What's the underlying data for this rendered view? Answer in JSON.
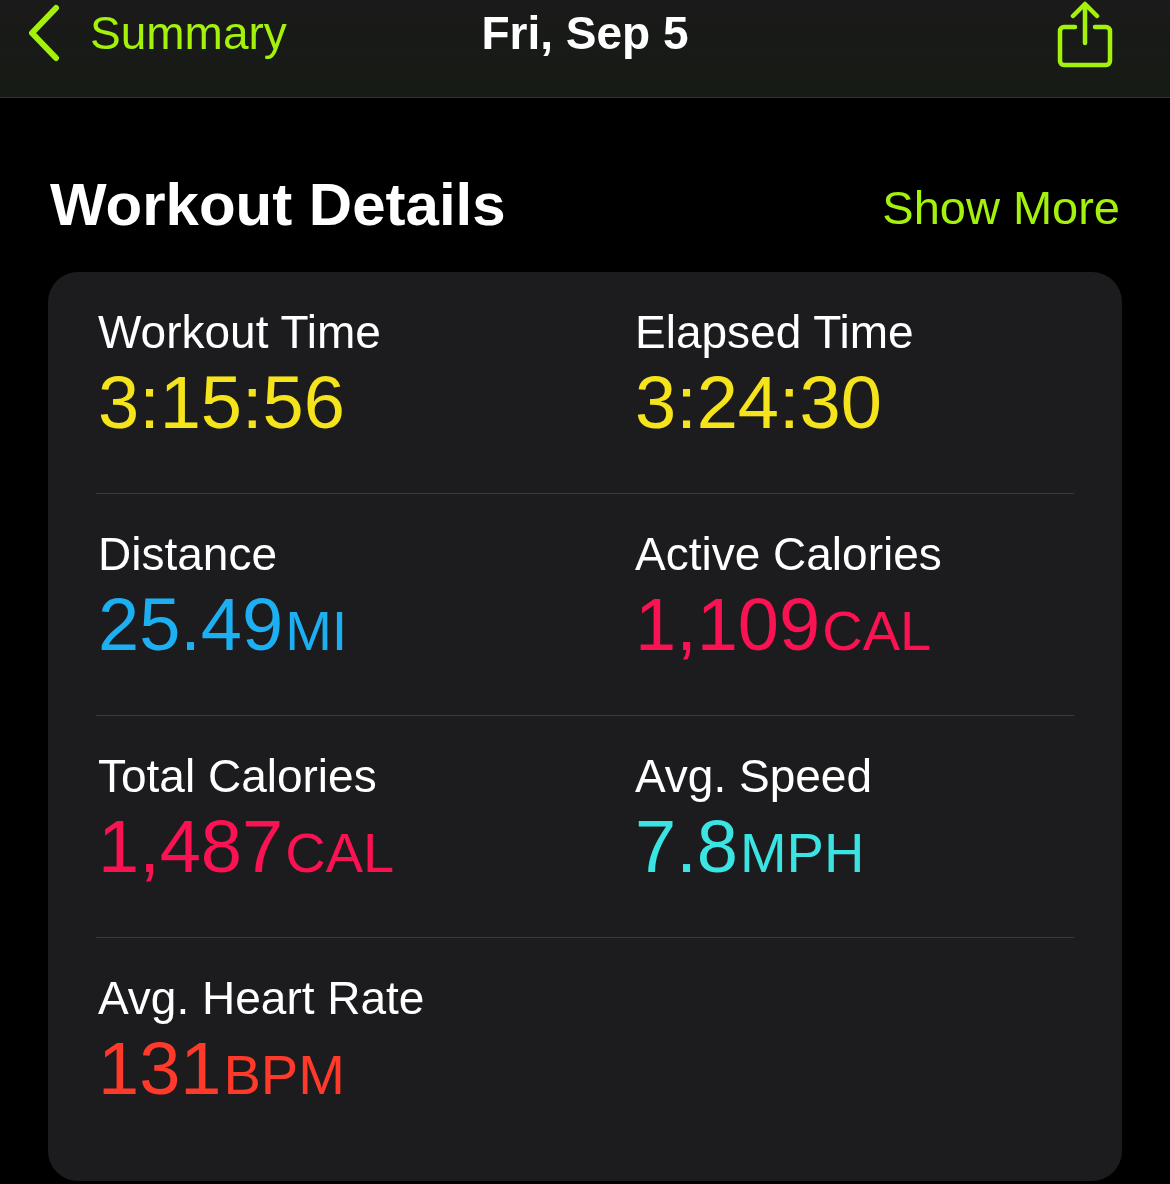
{
  "nav": {
    "back_label": "Summary",
    "title": "Fri, Sep 5"
  },
  "section": {
    "title": "Workout Details",
    "action": "Show More"
  },
  "metrics": [
    {
      "label": "Workout Time",
      "value": "3:15:56",
      "color": "#f5e41c"
    },
    {
      "label": "Elapsed Time",
      "value": "3:24:30",
      "color": "#f5e41c"
    },
    {
      "label": "Distance",
      "value": "25.49",
      "unit": "MI",
      "color": "#1caff2"
    },
    {
      "label": "Active Calories",
      "value": "1,109",
      "unit": "CAL",
      "color": "#fa1252"
    },
    {
      "label": "Total Calories",
      "value": "1,487",
      "unit": "CAL",
      "color": "#fa1252"
    },
    {
      "label": "Avg. Speed",
      "value": "7.8",
      "unit": "MPH",
      "color": "#3ce3e3"
    },
    {
      "label": "Avg. Heart Rate",
      "value": "131",
      "unit": "BPM",
      "color": "#ff3a2a"
    }
  ]
}
